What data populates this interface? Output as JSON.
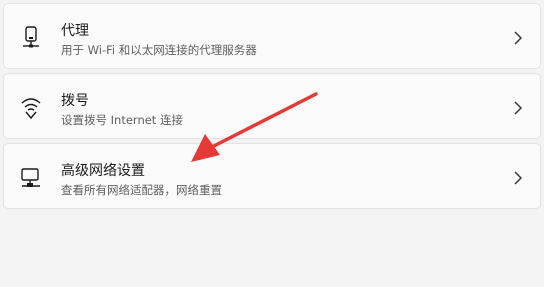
{
  "settings": {
    "rows": [
      {
        "title": "代理",
        "description": "用于 Wi-Fi 和以太网连接的代理服务器",
        "icon": "proxy-icon"
      },
      {
        "title": "拨号",
        "description": "设置拨号 Internet 连接",
        "icon": "dial-up-icon"
      },
      {
        "title": "高级网络设置",
        "description": "查看所有网络适配器，网络重置",
        "icon": "advanced-network-icon"
      }
    ]
  },
  "annotation": {
    "arrow_color": "#e53935"
  }
}
